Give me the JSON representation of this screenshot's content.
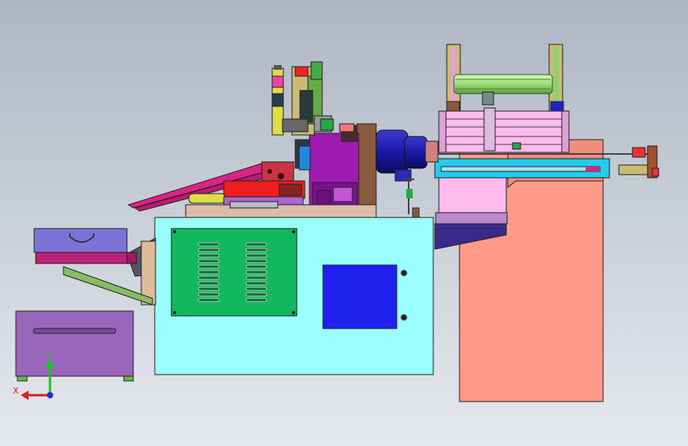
{
  "viewport": {
    "background_top": "#aeb6c3",
    "background_bottom": "#e6e9ed"
  },
  "triad": {
    "x_label": "X",
    "y_label": "Y",
    "x_color": "#e0201c",
    "y_color": "#20c030",
    "z_color": "#2030e0"
  },
  "colors": {
    "base_cabinet": "#99ffff",
    "vent_panel": "#12b85e",
    "control_box": "#2020ee",
    "side_stand": "#ff9a88",
    "bin_lower": "#9966bb",
    "bin_upper": "#7d72d6",
    "spindle_head": "#9e1ab0",
    "motor": "#1a1aa8",
    "frame_pink": "#ffbbee",
    "slide_blue": "#22ccee",
    "chute_magenta": "#dd2288",
    "block_red": "#ee1e1e",
    "hopper_tray": "#bb2277",
    "roller_green": "#99dd77",
    "column_khaki": "#ccbb77"
  }
}
